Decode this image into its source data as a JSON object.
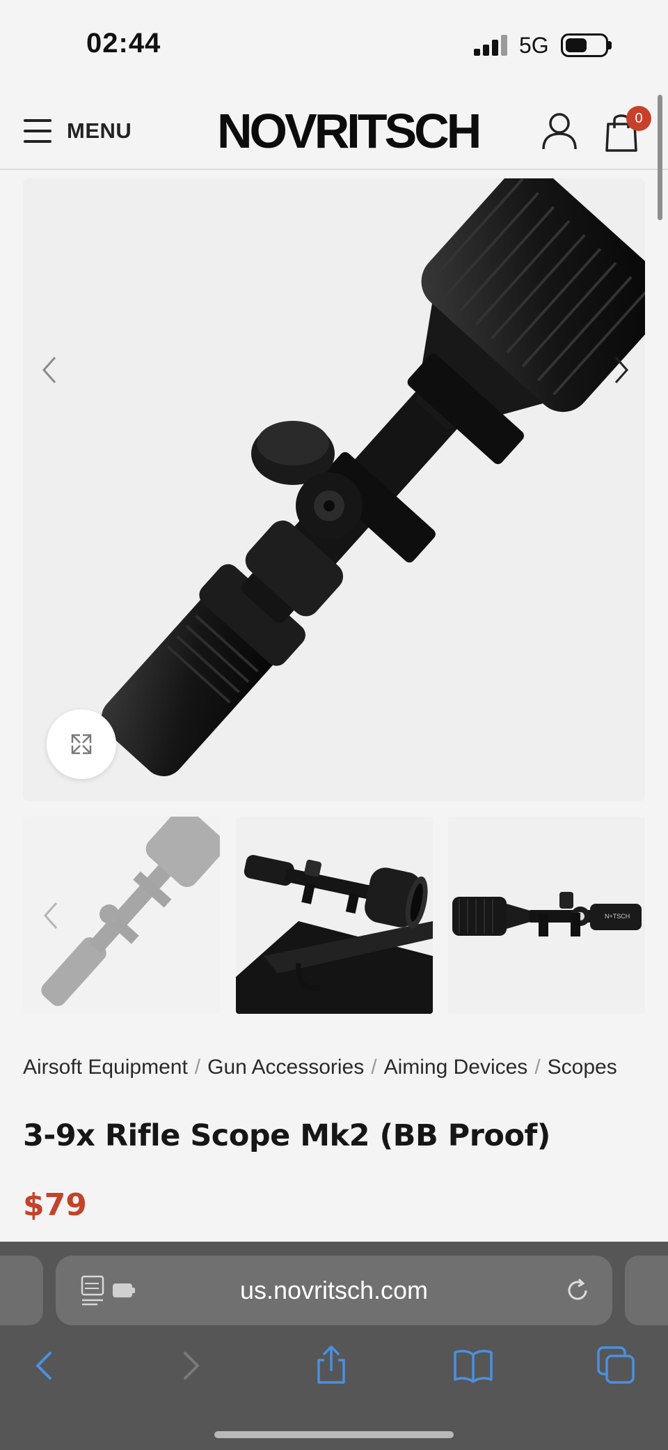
{
  "status_bar": {
    "time": "02:44",
    "network": "5G",
    "icons": [
      "signal-bars-icon",
      "battery-icon"
    ]
  },
  "header": {
    "menu_label": "MENU",
    "logo_text": "NOVRITSCH",
    "cart_count": "0",
    "icons": [
      "hamburger-icon",
      "account-icon",
      "cart-icon"
    ]
  },
  "gallery": {
    "main_image": "3-9x rifle scope angled view",
    "thumbnails": [
      {
        "description": "scope angled view (faded)"
      },
      {
        "description": "scope mounted on rifle"
      },
      {
        "description": "scope side view"
      }
    ],
    "icons": [
      "chevron-left-icon",
      "chevron-right-icon",
      "expand-icon"
    ]
  },
  "breadcrumb": {
    "items": [
      "Airsoft Equipment",
      "Gun Accessories",
      "Aiming Devices",
      "Scopes"
    ],
    "separator": "/"
  },
  "product": {
    "title": "3-9x Rifle Scope Mk2 (BB Proof)",
    "price": "$79"
  },
  "browser": {
    "url": "us.novritsch.com",
    "icons": [
      "reader-mode-icon",
      "reload-icon",
      "back-icon",
      "forward-icon",
      "share-icon",
      "bookmarks-icon",
      "tabs-icon"
    ]
  },
  "colors": {
    "accent_price": "#c3422a",
    "cart_badge": "#c8402a",
    "safari_blue": "#4a90e2",
    "safari_bar": "#565656"
  }
}
